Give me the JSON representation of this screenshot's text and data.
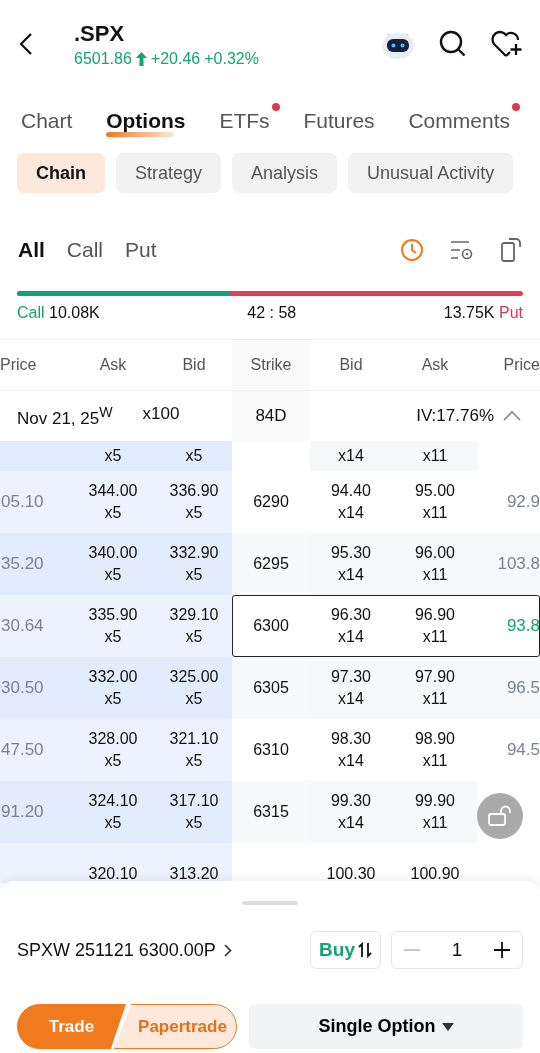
{
  "header": {
    "symbol": ".SPX",
    "price": "6501.86",
    "change": "+20.46",
    "change_pct": "+0.32%"
  },
  "tabs": [
    {
      "label": "Chart",
      "selected": false,
      "badge": false
    },
    {
      "label": "Options",
      "selected": true,
      "badge": false
    },
    {
      "label": "ETFs",
      "selected": false,
      "badge": true
    },
    {
      "label": "Futures",
      "selected": false,
      "badge": false
    },
    {
      "label": "Comments",
      "selected": false,
      "badge": true
    }
  ],
  "subtabs": [
    {
      "label": "Chain",
      "selected": true
    },
    {
      "label": "Strategy",
      "selected": false
    },
    {
      "label": "Analysis",
      "selected": false
    },
    {
      "label": "Unusual Activity",
      "selected": false
    }
  ],
  "filters": [
    {
      "label": "All",
      "selected": true
    },
    {
      "label": "Call",
      "selected": false
    },
    {
      "label": "Put",
      "selected": false
    }
  ],
  "ratio": {
    "call_label": "Call",
    "call_volume": "10.08K",
    "ratio": "42 : 58",
    "put_volume": "13.75K",
    "put_label": "Put",
    "level": 0.42
  },
  "table": {
    "columns": [
      "Price",
      "Ask",
      "Bid",
      "Strike",
      "Bid",
      "Ask",
      "Price"
    ],
    "expiry": {
      "date": "Nov 21, 25",
      "mark": "W",
      "multiplier": "x100",
      "days": "84D",
      "iv": "IV:17.76%",
      "expanded": true
    },
    "rows": [
      {
        "call_ask_size": "x5",
        "call_bid_size": "x5",
        "put_bid_size": "x14",
        "put_ask_size": "x11",
        "selected": false
      },
      {
        "call_price": "05.10",
        "call_ask": "344.00",
        "call_ask_size": "x5",
        "call_bid": "336.90",
        "call_bid_size": "x5",
        "strike": "6290",
        "put_bid": "94.40",
        "put_bid_size": "x14",
        "put_ask": "95.00",
        "put_ask_size": "x11",
        "put_price": "92.9",
        "color": "#7a8190",
        "selected": false
      },
      {
        "call_price": "35.20",
        "call_ask": "340.00",
        "call_ask_size": "x5",
        "call_bid": "332.90",
        "call_bid_size": "x5",
        "strike": "6295",
        "put_bid": "95.30",
        "put_bid_size": "x14",
        "put_ask": "96.00",
        "put_ask_size": "x11",
        "put_price": "103.8",
        "color": "#7a8190",
        "selected": false
      },
      {
        "call_price": "30.64",
        "call_ask": "335.90",
        "call_ask_size": "x5",
        "call_bid": "329.10",
        "call_bid_size": "x5",
        "strike": "6300",
        "put_bid": "96.30",
        "put_bid_size": "x14",
        "put_ask": "96.90",
        "put_ask_size": "x11",
        "put_price": "93.8",
        "color": "#16a274",
        "selected": true
      },
      {
        "call_price": "30.50",
        "call_ask": "332.00",
        "call_ask_size": "x5",
        "call_bid": "325.00",
        "call_bid_size": "x5",
        "strike": "6305",
        "put_bid": "97.30",
        "put_bid_size": "x14",
        "put_ask": "97.90",
        "put_ask_size": "x11",
        "put_price": "96.5",
        "color": "#7a8190",
        "selected": false
      },
      {
        "call_price": "47.50",
        "call_ask": "328.00",
        "call_ask_size": "x5",
        "call_bid": "321.10",
        "call_bid_size": "x5",
        "strike": "6310",
        "put_bid": "98.30",
        "put_bid_size": "x14",
        "put_ask": "98.90",
        "put_ask_size": "x11",
        "put_price": "94.5",
        "color": "#7a8190",
        "selected": false
      },
      {
        "call_price": "91.20",
        "call_ask": "324.10",
        "call_ask_size": "x5",
        "call_bid": "317.10",
        "call_bid_size": "x5",
        "strike": "6315",
        "put_bid": "99.30",
        "put_bid_size": "x14",
        "put_ask": "99.90",
        "put_ask_size": "x11",
        "selected": false
      },
      {
        "call_ask": "320.10",
        "call_bid": "313.20",
        "put_bid": "100.30",
        "put_ask": "100.90",
        "selected": false
      }
    ]
  },
  "order": {
    "contract": "SPXW 251121 6300.00P",
    "side": "Buy",
    "quantity": "1",
    "modes": [
      {
        "label": "Trade",
        "selected": true
      },
      {
        "label": "Papertrade",
        "selected": false
      }
    ],
    "strategy": "Single Option"
  }
}
